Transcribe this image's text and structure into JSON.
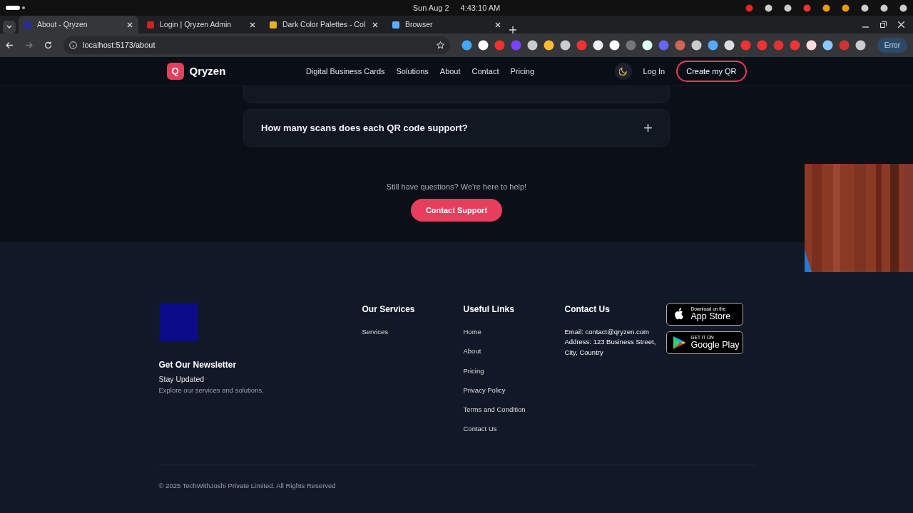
{
  "system_bar": {
    "date": "Sun Aug 2",
    "time": "4:43:10 AM"
  },
  "tabs": [
    {
      "title": "About - Qryzen",
      "selected": true
    },
    {
      "title": "Login | Qryzen Admin",
      "selected": false
    },
    {
      "title": "Dark Color Palettes - Col",
      "selected": false
    },
    {
      "title": "Browser",
      "selected": false
    }
  ],
  "address_bar": {
    "url": "localhost:5173/about"
  },
  "profile_button": {
    "label": "Error"
  },
  "navbar": {
    "logo_mark": "Q",
    "brand": "Qryzen",
    "links": [
      "Digital Business Cards",
      "Solutions",
      "About",
      "Contact",
      "Pricing"
    ],
    "login": "Log In",
    "cta": "Create my QR"
  },
  "faq": [
    {
      "question": "How many scans does each QR code support?",
      "expanded": false
    }
  ],
  "help": {
    "text": "Still have questions? We're here to help!",
    "button": "Contact Support"
  },
  "footer": {
    "newsletter_title": "Get Our Newsletter",
    "newsletter_subtitle": "Stay Updated",
    "newsletter_text": "Explore our services and solutions.",
    "columns": [
      {
        "title": "Our Services",
        "links": [
          "Services"
        ]
      },
      {
        "title": "Useful Links",
        "links": [
          "Home",
          "About",
          "Pricing",
          "Privacy Policy",
          "Terms and Condition",
          "Contact Us"
        ]
      },
      {
        "title": "Contact Us",
        "lines": [
          "Email: contact@qryzen.com",
          "Address: 123 Business Street, City, Country"
        ]
      }
    ],
    "badges": [
      {
        "kind": "apple",
        "small": "Download on the",
        "big": "App Store"
      },
      {
        "kind": "google",
        "small": "GET IT ON",
        "big": "Google Play"
      }
    ],
    "copyright": "© 2025 TechWithJoshi Private Limited. All Rights Reserved"
  }
}
